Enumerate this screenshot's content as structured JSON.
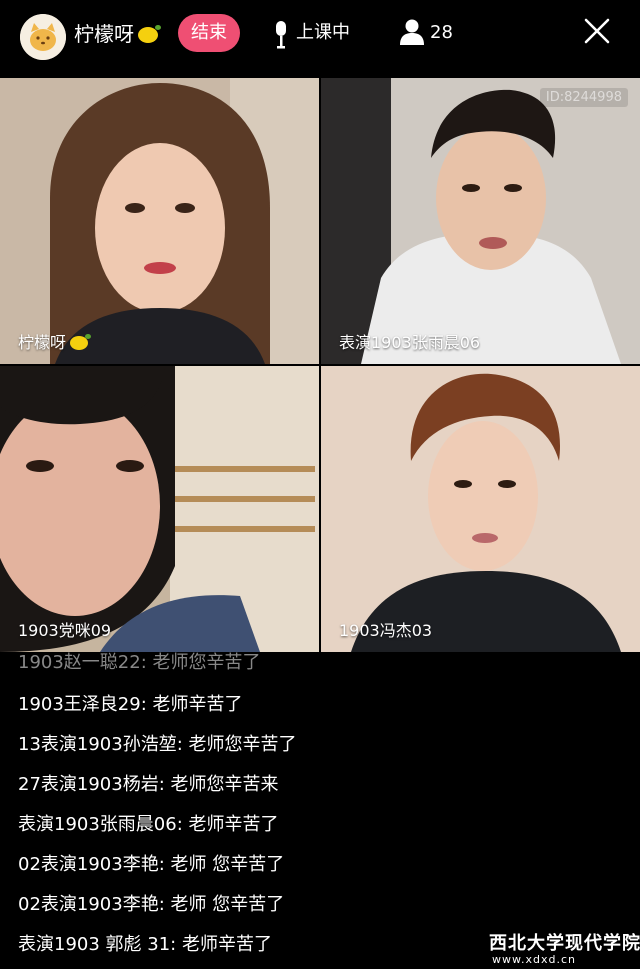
{
  "header": {
    "host_name": "柠檬呀",
    "end_button": "结束",
    "class_status": "上课中",
    "viewer_count": "28",
    "icons": [
      "avatar",
      "lemon-emoji",
      "microphone-icon",
      "person-icon",
      "close-icon"
    ]
  },
  "tiles": [
    {
      "label": "柠檬呀",
      "icon": "lemon-emoji"
    },
    {
      "label": "表演1903张雨晨06",
      "watermark": "ID:8244998"
    },
    {
      "label": "1903党咪09"
    },
    {
      "label": "1903冯杰03"
    }
  ],
  "chat": {
    "messages": [
      {
        "text": "1903赵一聪22: 老师您辛苦了",
        "faded": true
      },
      {
        "text": "1903王泽良29: 老师辛苦了"
      },
      {
        "text": "13表演1903孙浩堃: 老师您辛苦了"
      },
      {
        "text": "27表演1903杨岩: 老师您辛苦来"
      },
      {
        "text": "表演1903张雨晨06: 老师辛苦了"
      },
      {
        "text": "02表演1903李艳: 老师 您辛苦了"
      },
      {
        "text": "02表演1903李艳: 老师 您辛苦了"
      },
      {
        "text": "表演1903 郭彪 31: 老师辛苦了"
      }
    ]
  },
  "watermark": {
    "school_name": "西北大学现代学院",
    "url": "www.xdxd.cn"
  },
  "colors": {
    "background": "#000000",
    "end_button": "#ef4f73",
    "text": "#ffffff"
  }
}
